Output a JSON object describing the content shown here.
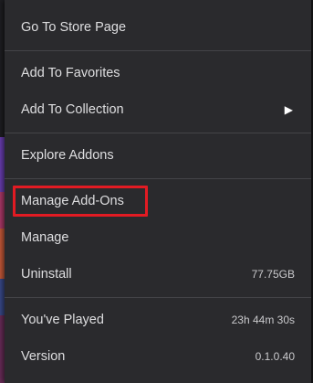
{
  "menu": {
    "items": [
      {
        "label": "Go To Store Page"
      },
      {
        "label": "Add To Favorites"
      },
      {
        "label": "Add To Collection",
        "submenu_icon": "triangle-right-icon"
      },
      {
        "label": "Explore Addons"
      },
      {
        "label": "Manage Add-Ons"
      },
      {
        "label": "Manage"
      },
      {
        "label": "Uninstall",
        "value": "77.75GB"
      },
      {
        "label": "You've Played",
        "value": "23h 44m 30s"
      },
      {
        "label": "Version",
        "value": "0.1.0.40"
      }
    ],
    "highlighted_item": "Manage Add-Ons"
  },
  "colors": {
    "menu_background": "#2a2a2d",
    "separator": "#444448",
    "text": "#dedee0",
    "highlight_border": "#e21b23"
  }
}
